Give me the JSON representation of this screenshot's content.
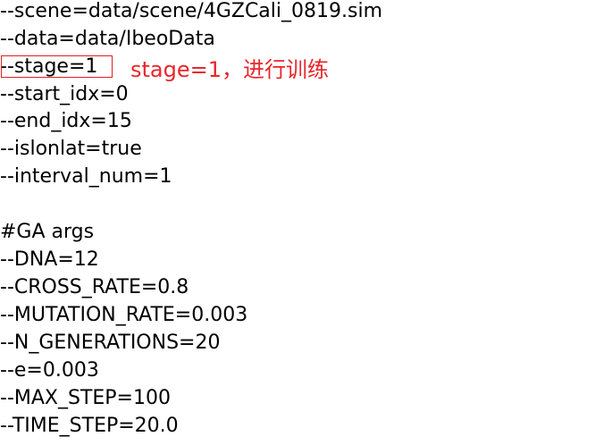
{
  "config_lines": [
    "--scene=data/scene/4GZCali_0819.sim",
    "--data=data/IbeoData",
    "--stage=1",
    "--start_idx=0",
    "--end_idx=15",
    "--islonlat=true",
    "--interval_num=1",
    "",
    "#GA args",
    "--DNA=12",
    "--CROSS_RATE=0.8",
    "--MUTATION_RATE=0.003",
    "--N_GENERATIONS=20",
    "--e=0.003",
    "--MAX_STEP=100",
    "--TIME_STEP=20.0"
  ],
  "annotation": {
    "text": "stage=1，进行训练",
    "color": "#e8262b"
  },
  "highlight_color": "#e02020"
}
